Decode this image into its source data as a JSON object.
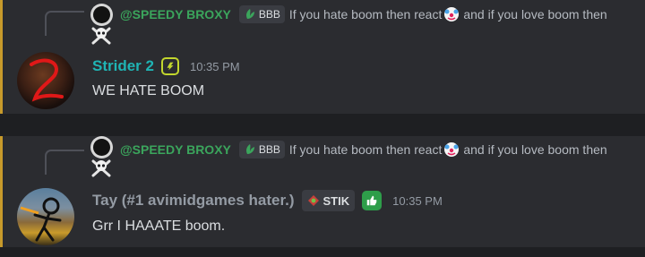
{
  "accent": "#c79a2b",
  "messages": [
    {
      "reply": {
        "username": "@SPEEDY BROXY",
        "guild_tag": "BBB",
        "text_before": "If you hate boom then react",
        "emoji": "clown-face-emoji",
        "text_after": "and if you love boom then"
      },
      "author": "Strider 2",
      "author_color": "#1fb4b4",
      "badge_icon": "lightning-bolt-badge-icon",
      "timestamp": "10:35 PM",
      "content": "WE HATE BOOM"
    },
    {
      "reply": {
        "username": "@SPEEDY BROXY",
        "guild_tag": "BBB",
        "text_before": "If you hate boom then react",
        "emoji": "clown-face-emoji",
        "text_after": "and if you love boom then"
      },
      "author": "Tay (#1 avimidgames hater.)",
      "author_color": "#949ba4",
      "guild_tag": "STIK",
      "badge_icon": "thumbs-up-badge-icon",
      "timestamp": "10:35 PM",
      "content": "Grr I HAAATE boom."
    }
  ]
}
